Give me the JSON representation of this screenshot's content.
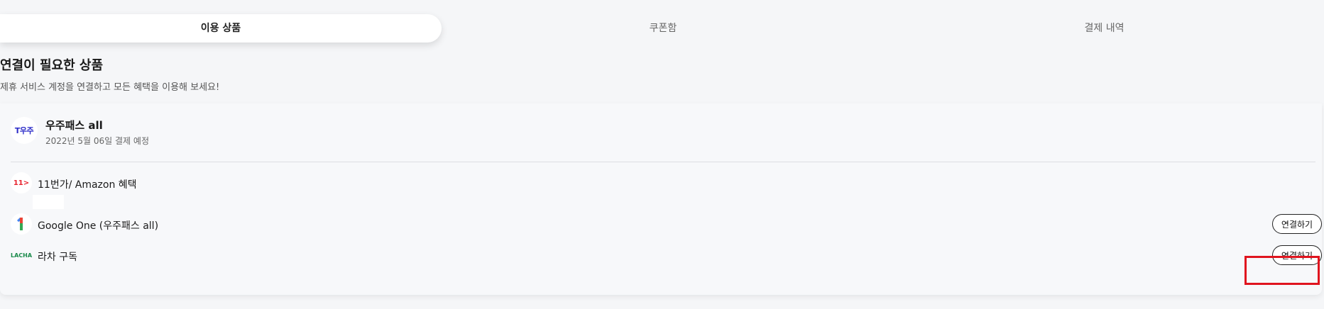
{
  "tabs": [
    {
      "label": "이용 상품",
      "active": true
    },
    {
      "label": "쿠폰함",
      "active": false
    },
    {
      "label": "결제 내역",
      "active": false
    }
  ],
  "section": {
    "title": "연결이 필요한 상품",
    "subtitle": "제휴 서비스 계정을 연결하고 모든 혜택을 이용해 보세요!"
  },
  "main_product": {
    "logo_text": "T우주",
    "title": "우주패스 all",
    "date": "2022년 5월 06일 결제 예정"
  },
  "items": [
    {
      "logo_text": "11>",
      "label": "11번가/ Amazon 혜택",
      "button": ""
    },
    {
      "logo_text": "1",
      "label": "Google One (우주패스 all)",
      "button": "연결하기"
    },
    {
      "logo_text": "LACHA",
      "label": "라차 구독",
      "button": "연결하기"
    }
  ],
  "colors": {
    "background": "#f5f6f8",
    "highlight": "#e0141e",
    "eleven_st": "#e8242f",
    "t_universe": "#2c2cc8"
  }
}
